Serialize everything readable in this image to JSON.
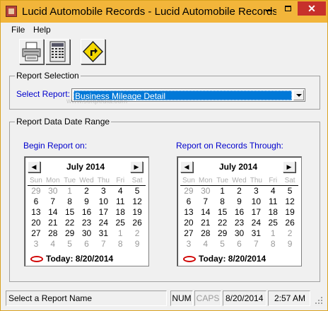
{
  "window": {
    "title": "Lucid Automobile Records -  Lucid Automobile Records -",
    "min_glyph": "minimize-icon",
    "max_glyph": "maximize-icon",
    "close_glyph": "✕"
  },
  "menu": {
    "file": "File",
    "help": "Help"
  },
  "toolbar": {
    "icons": [
      "printer-icon",
      "calculator-report-icon",
      "exit-sign-icon"
    ]
  },
  "report_selection": {
    "group_title": "Report Selection",
    "label": "Select Report:",
    "selected": "Business Mileage Detail"
  },
  "date_range": {
    "group_title": "Report Data Date Range",
    "begin_label": "Begin Report on:",
    "end_label": "Report on Records Through:"
  },
  "calendars": [
    {
      "month": "July 2014",
      "prev": "◀",
      "next": "▶",
      "dow": [
        "Sun",
        "Mon",
        "Tue",
        "Wed",
        "Thu",
        "Fri",
        "Sat"
      ],
      "days": [
        {
          "d": "29",
          "t": "other"
        },
        {
          "d": "30",
          "t": "other"
        },
        {
          "d": "1",
          "t": "selected"
        },
        {
          "d": "2",
          "t": ""
        },
        {
          "d": "3",
          "t": ""
        },
        {
          "d": "4",
          "t": ""
        },
        {
          "d": "5",
          "t": ""
        },
        {
          "d": "6",
          "t": ""
        },
        {
          "d": "7",
          "t": ""
        },
        {
          "d": "8",
          "t": ""
        },
        {
          "d": "9",
          "t": ""
        },
        {
          "d": "10",
          "t": ""
        },
        {
          "d": "11",
          "t": ""
        },
        {
          "d": "12",
          "t": ""
        },
        {
          "d": "13",
          "t": ""
        },
        {
          "d": "14",
          "t": ""
        },
        {
          "d": "15",
          "t": ""
        },
        {
          "d": "16",
          "t": ""
        },
        {
          "d": "17",
          "t": ""
        },
        {
          "d": "18",
          "t": ""
        },
        {
          "d": "19",
          "t": ""
        },
        {
          "d": "20",
          "t": ""
        },
        {
          "d": "21",
          "t": ""
        },
        {
          "d": "22",
          "t": ""
        },
        {
          "d": "23",
          "t": ""
        },
        {
          "d": "24",
          "t": ""
        },
        {
          "d": "25",
          "t": ""
        },
        {
          "d": "26",
          "t": ""
        },
        {
          "d": "27",
          "t": ""
        },
        {
          "d": "28",
          "t": ""
        },
        {
          "d": "29",
          "t": ""
        },
        {
          "d": "30",
          "t": ""
        },
        {
          "d": "31",
          "t": ""
        },
        {
          "d": "1",
          "t": "other"
        },
        {
          "d": "2",
          "t": "other"
        },
        {
          "d": "3",
          "t": "other"
        },
        {
          "d": "4",
          "t": "other"
        },
        {
          "d": "5",
          "t": "other"
        },
        {
          "d": "6",
          "t": "other"
        },
        {
          "d": "7",
          "t": "other"
        },
        {
          "d": "8",
          "t": "other"
        },
        {
          "d": "9",
          "t": "other"
        }
      ],
      "today": "Today: 8/20/2014"
    },
    {
      "month": "July 2014",
      "prev": "◀",
      "next": "▶",
      "dow": [
        "Sun",
        "Mon",
        "Tue",
        "Wed",
        "Thu",
        "Fri",
        "Sat"
      ],
      "days": [
        {
          "d": "29",
          "t": "other"
        },
        {
          "d": "30",
          "t": "other"
        },
        {
          "d": "1",
          "t": ""
        },
        {
          "d": "2",
          "t": ""
        },
        {
          "d": "3",
          "t": ""
        },
        {
          "d": "4",
          "t": ""
        },
        {
          "d": "5",
          "t": ""
        },
        {
          "d": "6",
          "t": ""
        },
        {
          "d": "7",
          "t": ""
        },
        {
          "d": "8",
          "t": ""
        },
        {
          "d": "9",
          "t": ""
        },
        {
          "d": "10",
          "t": ""
        },
        {
          "d": "11",
          "t": ""
        },
        {
          "d": "12",
          "t": ""
        },
        {
          "d": "13",
          "t": ""
        },
        {
          "d": "14",
          "t": ""
        },
        {
          "d": "15",
          "t": ""
        },
        {
          "d": "16",
          "t": ""
        },
        {
          "d": "17",
          "t": ""
        },
        {
          "d": "18",
          "t": ""
        },
        {
          "d": "19",
          "t": ""
        },
        {
          "d": "20",
          "t": ""
        },
        {
          "d": "21",
          "t": ""
        },
        {
          "d": "22",
          "t": ""
        },
        {
          "d": "23",
          "t": ""
        },
        {
          "d": "24",
          "t": ""
        },
        {
          "d": "25",
          "t": ""
        },
        {
          "d": "26",
          "t": ""
        },
        {
          "d": "27",
          "t": ""
        },
        {
          "d": "28",
          "t": ""
        },
        {
          "d": "29",
          "t": ""
        },
        {
          "d": "30",
          "t": ""
        },
        {
          "d": "31",
          "t": ""
        },
        {
          "d": "1",
          "t": "other"
        },
        {
          "d": "2",
          "t": "other"
        },
        {
          "d": "3",
          "t": "other"
        },
        {
          "d": "4",
          "t": "other"
        },
        {
          "d": "5",
          "t": "other"
        },
        {
          "d": "6",
          "t": "other"
        },
        {
          "d": "7",
          "t": "other"
        },
        {
          "d": "8",
          "t": "other"
        },
        {
          "d": "9",
          "t": "other"
        }
      ],
      "today": "Today: 8/20/2014"
    }
  ],
  "watermark": "www.softpedia.com",
  "status": {
    "message": "Select a Report Name",
    "num": "NUM",
    "caps": "CAPS",
    "date": "8/20/2014",
    "time": "2:57 AM"
  },
  "colors": {
    "titlebar": "#f2b53a",
    "close": "#c7312b",
    "label_blue": "#0000cc",
    "selection": "#0078d7",
    "today_circle": "#d00000"
  }
}
